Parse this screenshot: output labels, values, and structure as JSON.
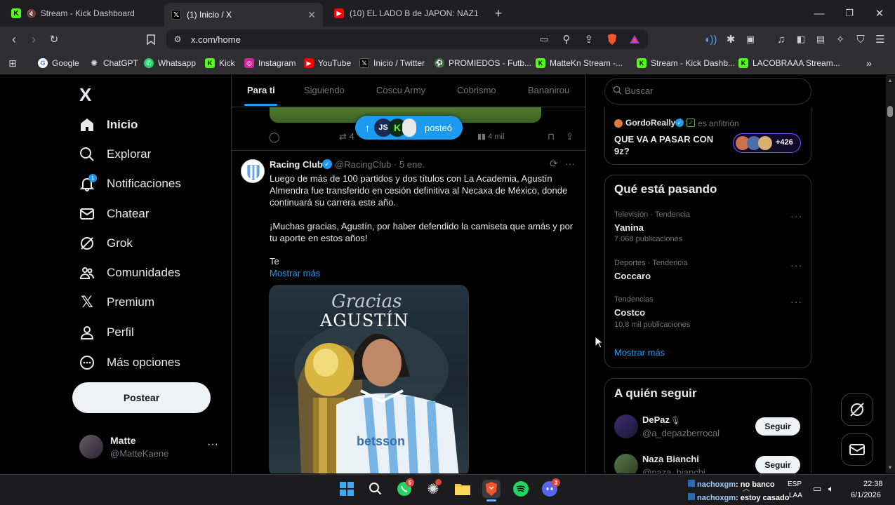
{
  "browser": {
    "tabs": [
      {
        "title": "Stream - Kick Dashboard",
        "favicon": "kick-icon"
      },
      {
        "title": "(1) Inicio / X",
        "favicon": "x-icon"
      },
      {
        "title": "(10) EL LADO B de JAPON: NAZ1SMO",
        "favicon": "youtube-icon"
      }
    ],
    "new_tab": "+",
    "url": "x.com/home",
    "bookmarks": [
      "Google",
      "ChatGPT",
      "Whatsapp",
      "Kick",
      "Instagram",
      "YouTube",
      "Inicio / Twitter",
      "PROMIEDOS - Futb...",
      "MatteKn Stream -...",
      "Stream - Kick Dashb...",
      "LACOBRAAA Stream..."
    ],
    "bookmarks_more": "»"
  },
  "sidebar": {
    "logo": "X",
    "items": [
      {
        "label": "Inicio",
        "icon": "home-icon"
      },
      {
        "label": "Explorar",
        "icon": "search-icon"
      },
      {
        "label": "Notificaciones",
        "icon": "bell-icon"
      },
      {
        "label": "Chatear",
        "icon": "mail-icon"
      },
      {
        "label": "Grok",
        "icon": "grok-icon"
      },
      {
        "label": "Comunidades",
        "icon": "people-icon"
      },
      {
        "label": "Premium",
        "icon": "x-icon"
      },
      {
        "label": "Perfil",
        "icon": "person-icon"
      },
      {
        "label": "Más opciones",
        "icon": "more-circle-icon"
      }
    ],
    "notif_badge": "1",
    "post_button": "Postear",
    "account_name": "Matte",
    "account_handle": "@MatteKaene",
    "account_more": "···"
  },
  "timeline": {
    "tabs": [
      "Para ti",
      "Siguiendo",
      "Coscu Army",
      "Cobrismo",
      "Bananirou"
    ],
    "prev_tweet_actions": {
      "retweets": "4",
      "views": "4 mil"
    },
    "posted_pill": "posteó",
    "tweet": {
      "author": "Racing Club",
      "handle": "@RacingClub",
      "date": "· 5 ene.",
      "text1": "Luego de más de 100 partidos y dos títulos con La Academia, Agustín",
      "text2": "Almendra fue transferido en cesión definitiva al Necaxa de México, donde",
      "text3": "continuará su carrera este año.",
      "text4": "¡Muchas gracias, Agustín, por haber defendido la camiseta que amás y por",
      "text5": "tu aporte en estos años!",
      "text6": "Te",
      "show_more": "Mostrar más",
      "image_title_script": "Gracias",
      "image_title": "AGUSTÍN",
      "jersey_sponsor": "betsson"
    }
  },
  "right": {
    "search_placeholder": "Buscar",
    "space": {
      "host": "GordoReally",
      "role": "es anfitrión",
      "title1": "QUE VA A PASAR CON",
      "title2": "9z?",
      "count": "+426"
    },
    "trends_title": "Qué está pasando",
    "trends": [
      {
        "meta": "Televisión · Tendencia",
        "name": "Yanina",
        "posts": "7.068 publicaciones"
      },
      {
        "meta": "Deportes · Tendencia",
        "name": "Coccaro",
        "posts": ""
      },
      {
        "meta": "Tendencias",
        "name": "Costco",
        "posts": "10,8 mil publicaciones"
      }
    ],
    "trends_more": "Mostrar más",
    "follow_title": "A quién seguir",
    "follow": [
      {
        "name": "DePaz",
        "handle": "@a_depazberrocal",
        "button": "Seguir"
      },
      {
        "name": "Naza Bianchi",
        "handle": "@naza_bianchi",
        "button": "Seguir"
      }
    ]
  },
  "taskbar": {
    "chat1_user": "nachoxgm",
    "chat1_msg": ": no banco",
    "chat2_user": "nachoxgm",
    "chat2_msg": ": estoy casado",
    "lang1": "ESP",
    "lang2": "LAA",
    "time": "22:38",
    "date": "6/1/2026",
    "whatsapp_badge": "5",
    "discord_badge": "3"
  },
  "colors": {
    "accent": "#1d9bf0",
    "kick": "#53fc18",
    "bg": "#000000",
    "border": "#2f3336"
  }
}
